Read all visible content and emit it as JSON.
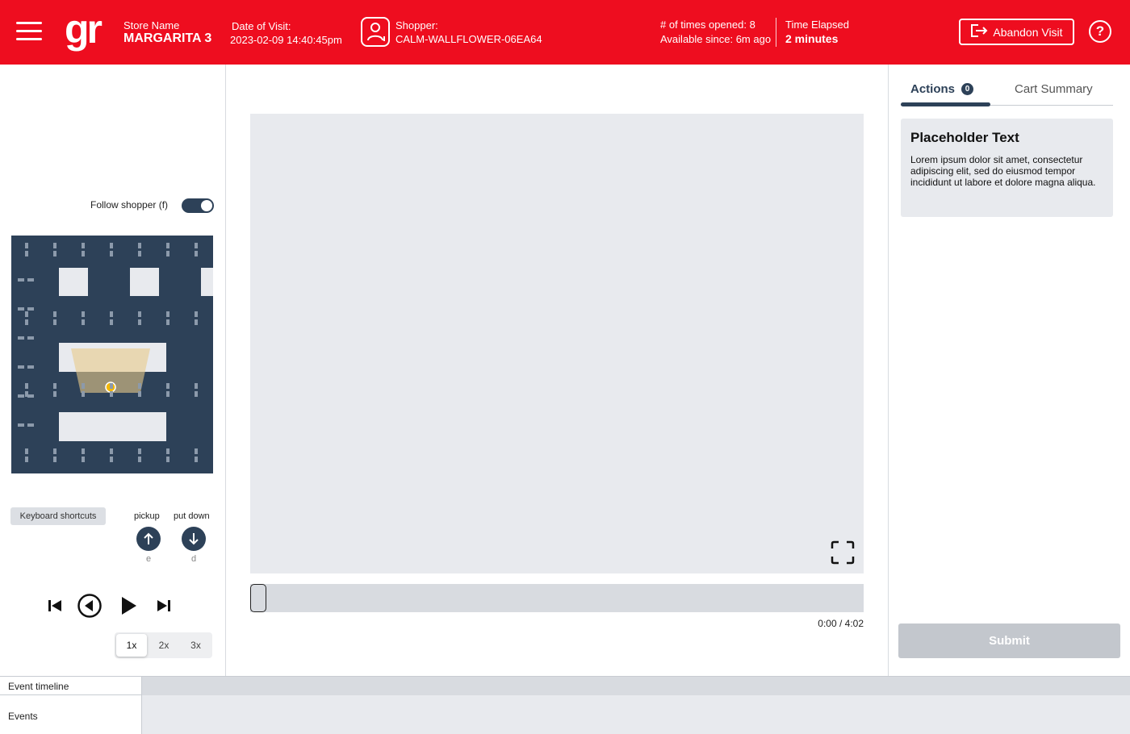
{
  "header": {
    "logo_text": "gr",
    "store_label": "Store Name",
    "store_name": "MARGARITA 3",
    "date_label": "Date of Visit:",
    "date_value": "2023-02-09 14:40:45pm",
    "shopper_label": "Shopper:",
    "shopper_value": "CALM-WALLFLOWER-06EA64",
    "times_opened": "# of times opened: 8",
    "available_since": "Available since: 6m ago",
    "time_elapsed_label": "Time Elapsed",
    "time_elapsed_value": "2 minutes",
    "abandon_label": "Abandon Visit",
    "help_glyph": "?",
    "accent_color": "#ee0d1f"
  },
  "left": {
    "follow_label": "Follow shopper (f)",
    "follow_enabled": true,
    "keyboard_shortcuts_label": "Keyboard shortcuts",
    "pickup_label": "pickup",
    "pickup_key": "e",
    "putdown_label": "put down",
    "putdown_key": "d",
    "speeds": [
      "1x",
      "2x",
      "3x"
    ],
    "selected_speed": "1x",
    "map_color": "#2d4158"
  },
  "player": {
    "time_display": "0:00 / 4:02"
  },
  "right": {
    "tab_actions": "Actions",
    "actions_count": "0",
    "tab_cart": "Cart Summary",
    "card_title": "Placeholder Text",
    "card_body": "Lorem ipsum dolor sit amet, consectetur adipiscing elit, sed do eiusmod tempor incididunt ut labore et dolore magna aliqua.",
    "submit_label": "Submit"
  },
  "bottom": {
    "timeline_label": "Event timeline",
    "events_label": "Events"
  }
}
